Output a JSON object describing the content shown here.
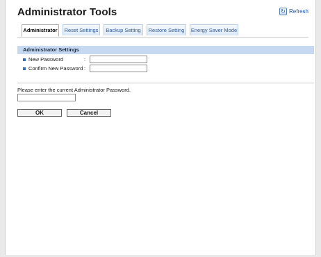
{
  "header": {
    "title": "Administrator Tools",
    "refresh_label": "Refresh",
    "refresh_icon": "refresh-icon"
  },
  "tabs": [
    {
      "label": "Administrator",
      "active": true
    },
    {
      "label": "Reset Settings",
      "active": false
    },
    {
      "label": "Backup Setting",
      "active": false
    },
    {
      "label": "Restore Setting",
      "active": false
    },
    {
      "label": "Energy Saver Mode",
      "active": false
    }
  ],
  "section": {
    "title": "Administrator Settings",
    "fields": [
      {
        "label": "New Password",
        "separator": ":",
        "value": ""
      },
      {
        "label": "Confirm New Password",
        "separator": ":",
        "value": ""
      }
    ]
  },
  "current_password": {
    "prompt": "Please enter the current Administrator Password.",
    "value": ""
  },
  "buttons": {
    "ok_label": "OK",
    "cancel_label": "Cancel"
  },
  "colors": {
    "section_header": "#c6d9f0",
    "bullet": "#3b6cb0",
    "tab_inactive_bg": "#dbe8f7"
  }
}
